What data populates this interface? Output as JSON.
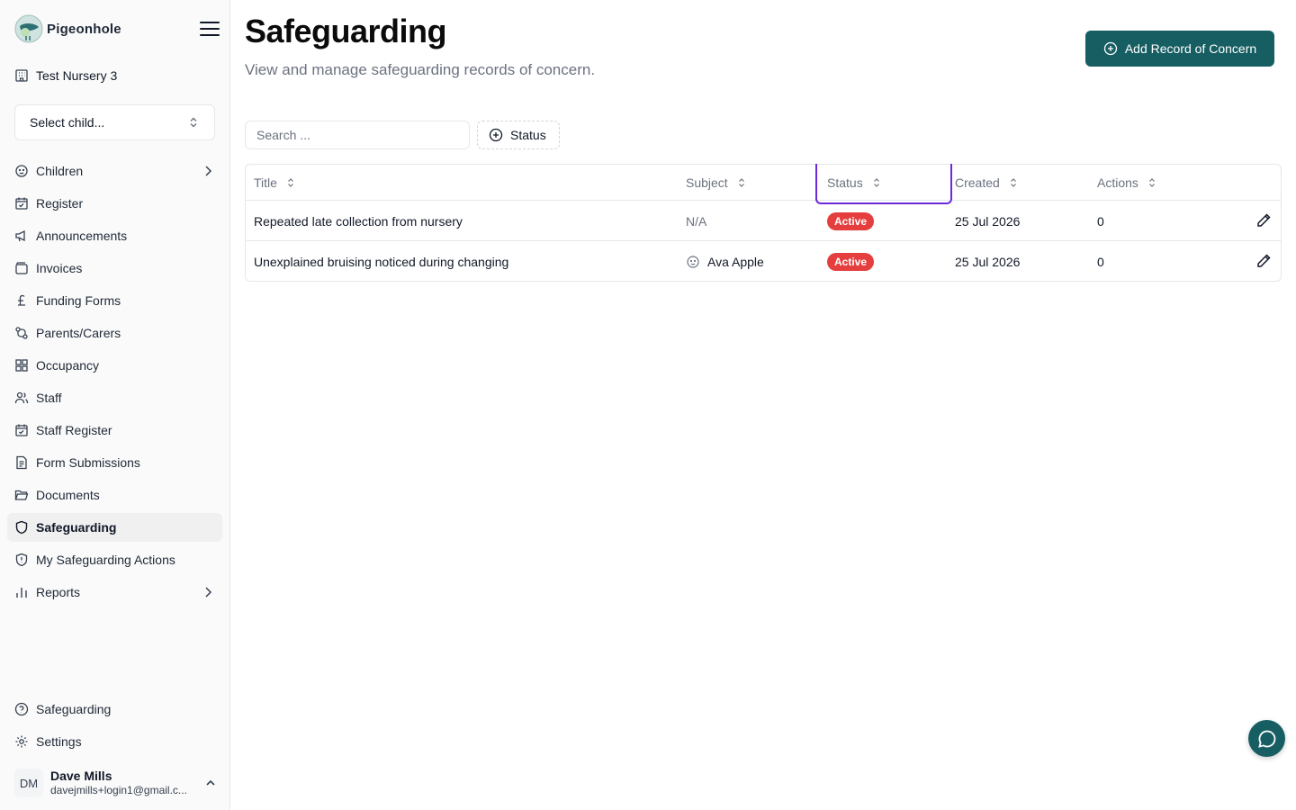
{
  "app": {
    "name": "Pigeonhole"
  },
  "nursery": {
    "name": "Test Nursery 3"
  },
  "child_select": {
    "placeholder": "Select child..."
  },
  "sidebar": {
    "items": [
      {
        "label": "Children",
        "icon": "child-face-icon",
        "has_submenu": true
      },
      {
        "label": "Register",
        "icon": "calendar-check-icon"
      },
      {
        "label": "Announcements",
        "icon": "megaphone-icon"
      },
      {
        "label": "Invoices",
        "icon": "wallet-icon"
      },
      {
        "label": "Funding Forms",
        "icon": "pound-icon"
      },
      {
        "label": "Parents/Carers",
        "icon": "git-compare-icon"
      },
      {
        "label": "Occupancy",
        "icon": "grid-icon"
      },
      {
        "label": "Staff",
        "icon": "users-icon"
      },
      {
        "label": "Staff Register",
        "icon": "calendar-check-icon"
      },
      {
        "label": "Form Submissions",
        "icon": "file-text-icon"
      },
      {
        "label": "Documents",
        "icon": "folder-open-icon"
      },
      {
        "label": "Safeguarding",
        "icon": "shield-icon",
        "active": true
      },
      {
        "label": "My Safeguarding Actions",
        "icon": "shield-alert-icon"
      },
      {
        "label": "Reports",
        "icon": "bar-chart-icon",
        "has_submenu": true
      }
    ],
    "bottom": [
      {
        "label": "Safeguarding",
        "icon": "help-circle-icon"
      },
      {
        "label": "Settings",
        "icon": "gear-icon"
      }
    ]
  },
  "user": {
    "initials": "DM",
    "name": "Dave Mills",
    "email": "davejmills+login1@gmail.c..."
  },
  "page": {
    "title": "Safeguarding",
    "subtitle": "View and manage safeguarding records of concern.",
    "add_button": "Add Record of Concern"
  },
  "filters": {
    "search_placeholder": "Search ...",
    "status_label": "Status"
  },
  "table": {
    "columns": [
      "Title",
      "Subject",
      "Status",
      "Created",
      "Actions"
    ],
    "rows": [
      {
        "title": "Repeated late collection from nursery",
        "subject": "N/A",
        "status": "Active",
        "created": "25 Jul 2026",
        "actions": "0"
      },
      {
        "title": "Unexplained bruising noticed during changing",
        "subject": "Ava Apple",
        "status": "Active",
        "created": "25 Jul 2026",
        "actions": "0"
      }
    ]
  },
  "colors": {
    "primary": "#175e63",
    "active_badge": "#e53e3e",
    "highlight": "#6d28d9"
  }
}
